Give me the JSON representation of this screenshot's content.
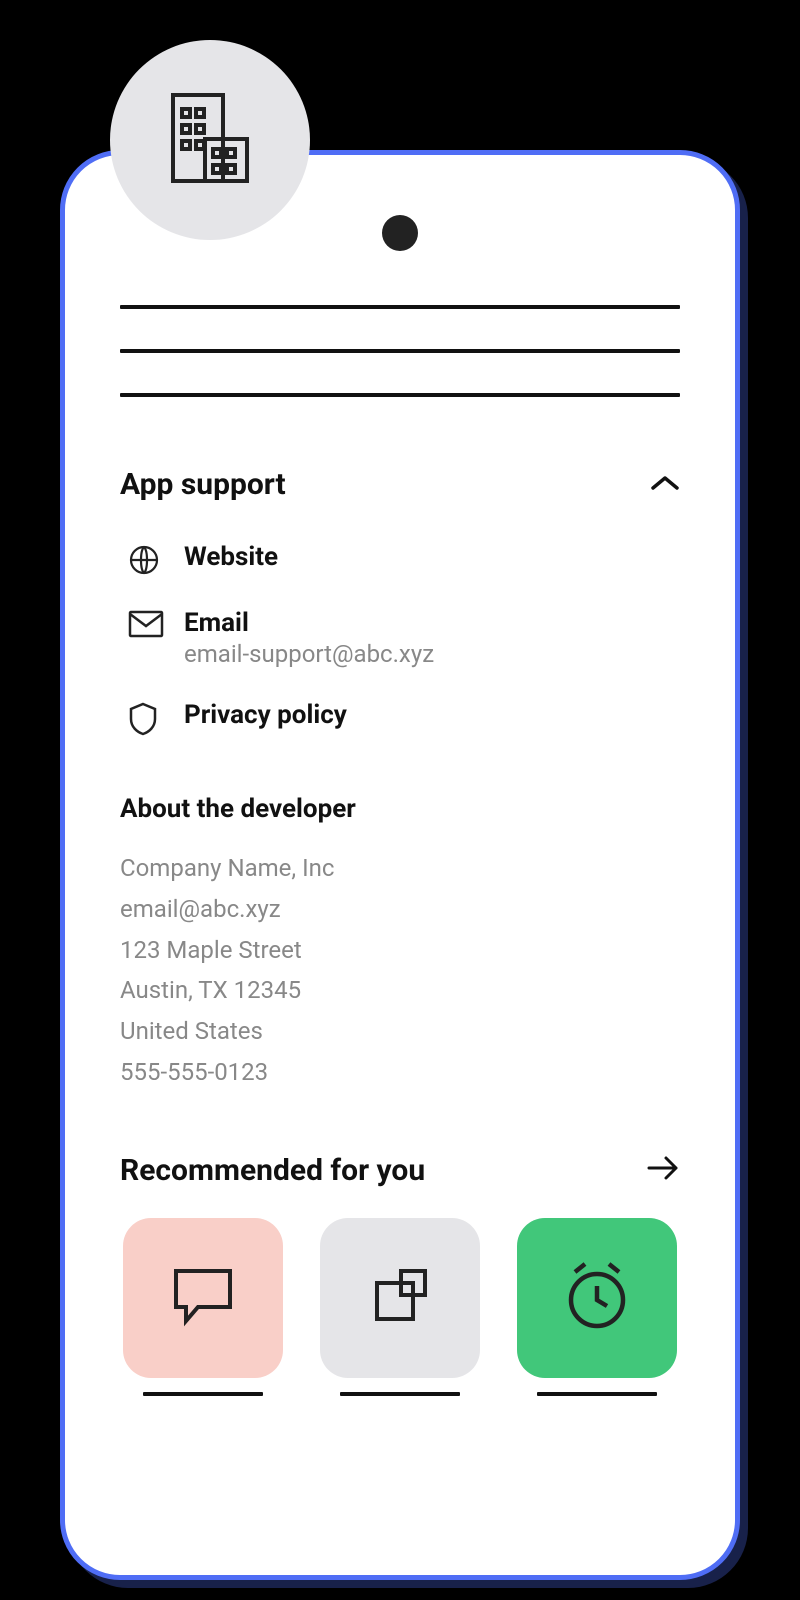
{
  "sections": {
    "app_support": {
      "title": "App support",
      "items": {
        "website": {
          "label": "Website"
        },
        "email": {
          "label": "Email",
          "value": "email-support@abc.xyz"
        },
        "privacy": {
          "label": "Privacy policy"
        }
      }
    },
    "about_developer": {
      "title": "About the developer",
      "company": "Company Name, Inc",
      "email": "email@abc.xyz",
      "street": "123 Maple Street",
      "city_state": "Austin, TX 12345",
      "country": "United States",
      "phone": "555-555-0123"
    },
    "recommended": {
      "title": "Recommended for you"
    }
  },
  "colors": {
    "accent": "#4f6df5",
    "tile_pink": "#f9cfc8",
    "tile_grey": "#e5e5e8",
    "tile_green": "#41c77a"
  }
}
